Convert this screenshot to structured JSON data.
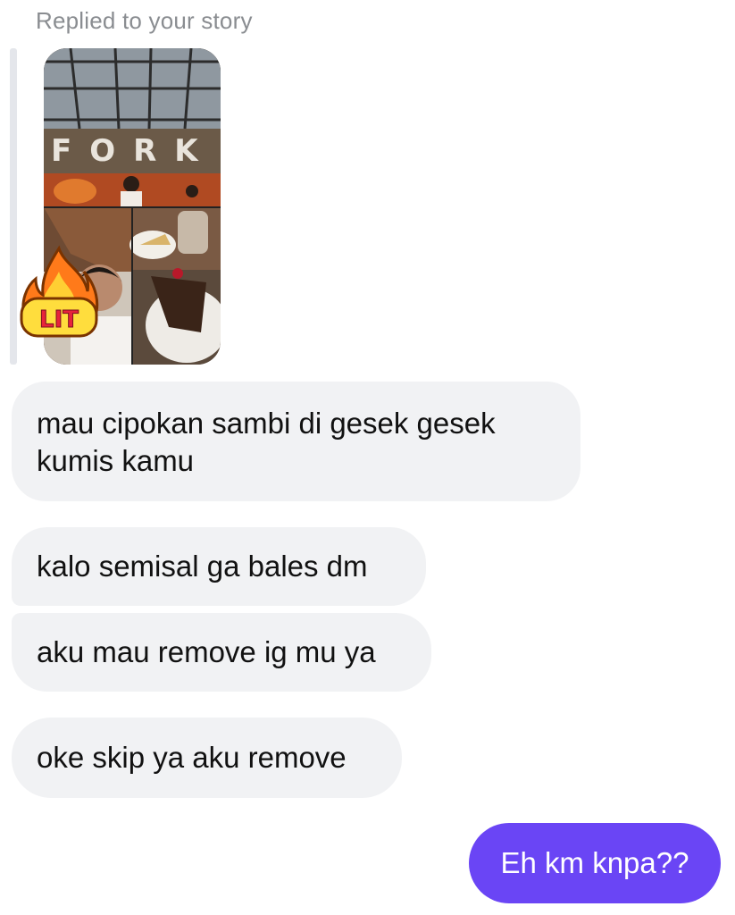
{
  "thread": {
    "replied_label": "Replied to your story",
    "story": {
      "sign_text": "FORK",
      "sticker_text": "LIT",
      "sticker_icon": "fire-icon"
    },
    "messages": [
      {
        "sender": "them",
        "text": "mau cipokan sambi di gesek gesek kumis kamu"
      },
      {
        "sender": "them",
        "text": "kalo semisal ga bales dm"
      },
      {
        "sender": "them",
        "text": "aku mau remove ig mu ya"
      },
      {
        "sender": "them",
        "text": "oke skip ya aku remove"
      },
      {
        "sender": "me",
        "text": "Eh km knpa??"
      }
    ]
  },
  "colors": {
    "incoming_bubble": "#f1f2f4",
    "outgoing_bubble": "#6a45f5",
    "label_gray": "#8a8d91"
  }
}
